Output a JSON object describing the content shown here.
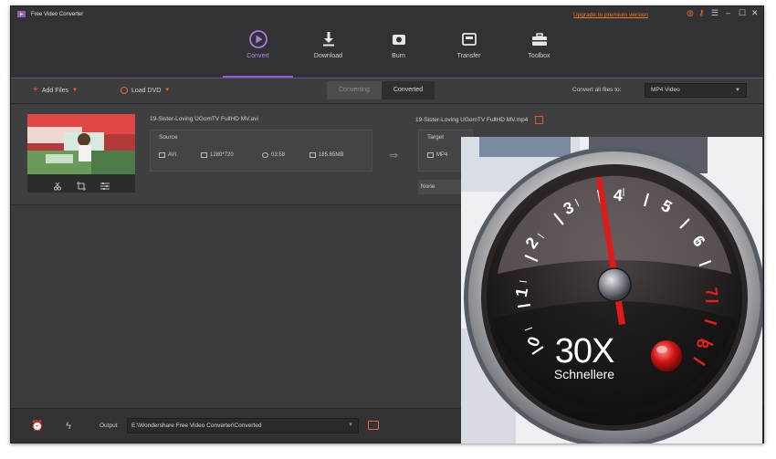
{
  "window": {
    "title": "Free Video Converter",
    "upgrade_link": "Upgrade to premium version"
  },
  "nav": [
    {
      "label": "Convert",
      "icon": "play-circle-icon",
      "active": true
    },
    {
      "label": "Download",
      "icon": "download-icon"
    },
    {
      "label": "Burn",
      "icon": "disc-icon"
    },
    {
      "label": "Transfer",
      "icon": "transfer-icon"
    },
    {
      "label": "Toolbox",
      "icon": "toolbox-icon"
    }
  ],
  "toolbar": {
    "add_files": "Add Files",
    "load_dvd": "Load DVD",
    "tab_converting": "Converting",
    "tab_converted": "Converted",
    "convert_all_label": "Convert all files to:",
    "format_value": "MP4 Video"
  },
  "file": {
    "source_name": "19-Sister-Loving UGomTV FullHD MV.avi",
    "target_name": "19-Sister-Loving UGomTV FullHD MV.mp4",
    "source_label": "Source",
    "target_label": "Target",
    "source_format": "AVI",
    "source_resolution": "1280*720",
    "source_duration": "03:58",
    "source_size": "185.65MB",
    "target_format": "MP4",
    "subtitle_value": "None"
  },
  "bottom": {
    "output_label": "Output",
    "output_path": "E:\\Wondershare Free Video Converter\\Converted"
  },
  "gauge": {
    "numbers": [
      "0",
      "1",
      "2",
      "3",
      "4",
      "5",
      "6",
      "7",
      "8"
    ],
    "big_text": "30X",
    "sub_text": "Schnellere"
  },
  "colors": {
    "accent_purple": "#8b60c9",
    "accent_orange": "#e86a3b",
    "window_bg": "#3b3a3c"
  }
}
